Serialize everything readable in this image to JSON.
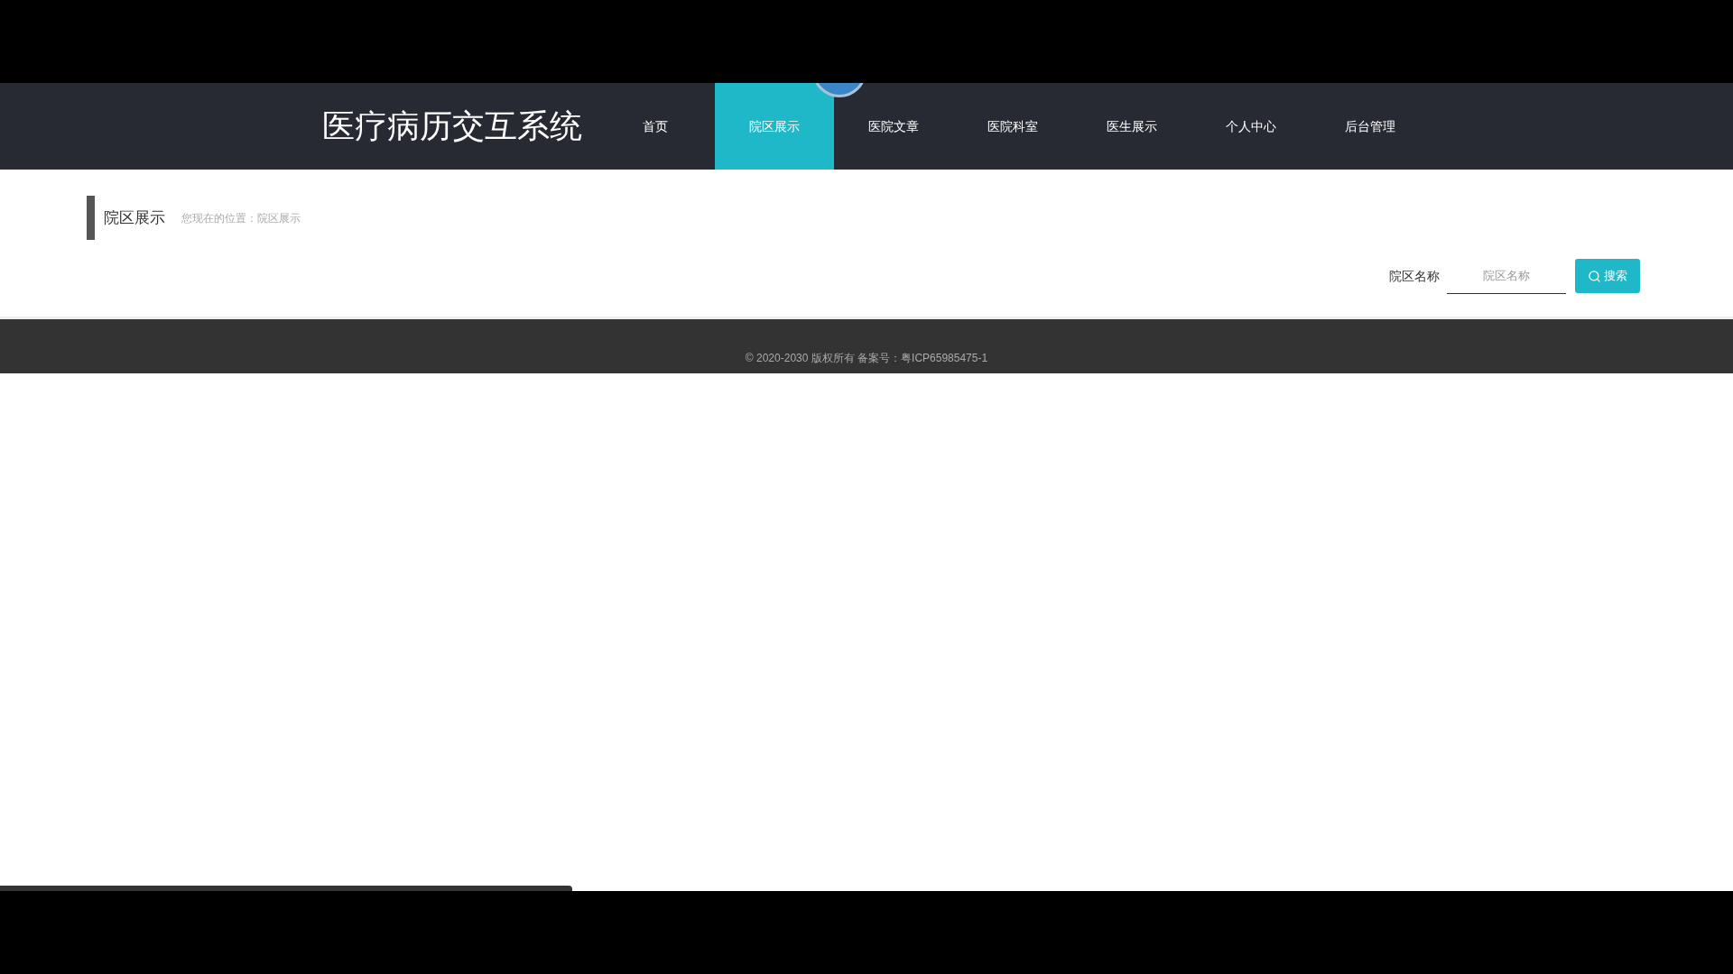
{
  "header": {
    "title": "医疗病历交互系统",
    "nav": [
      {
        "label": "首页",
        "selected": false
      },
      {
        "label": "院区展示",
        "selected": true
      },
      {
        "label": "医院文章",
        "selected": false
      },
      {
        "label": "医院科室",
        "selected": false
      },
      {
        "label": "医生展示",
        "selected": false
      },
      {
        "label": "个人中心",
        "selected": false
      },
      {
        "label": "后台管理",
        "selected": false
      }
    ]
  },
  "section": {
    "title": "院区展示",
    "breadcrumb": "您现在的位置：院区展示"
  },
  "search": {
    "label": "院区名称",
    "placeholder": "院区名称",
    "button": "搜索"
  },
  "footer": {
    "text": "© 2020-2030 版权所有 备案号：粤ICP65985475-1"
  },
  "video_progress": {
    "level": 0.33
  }
}
